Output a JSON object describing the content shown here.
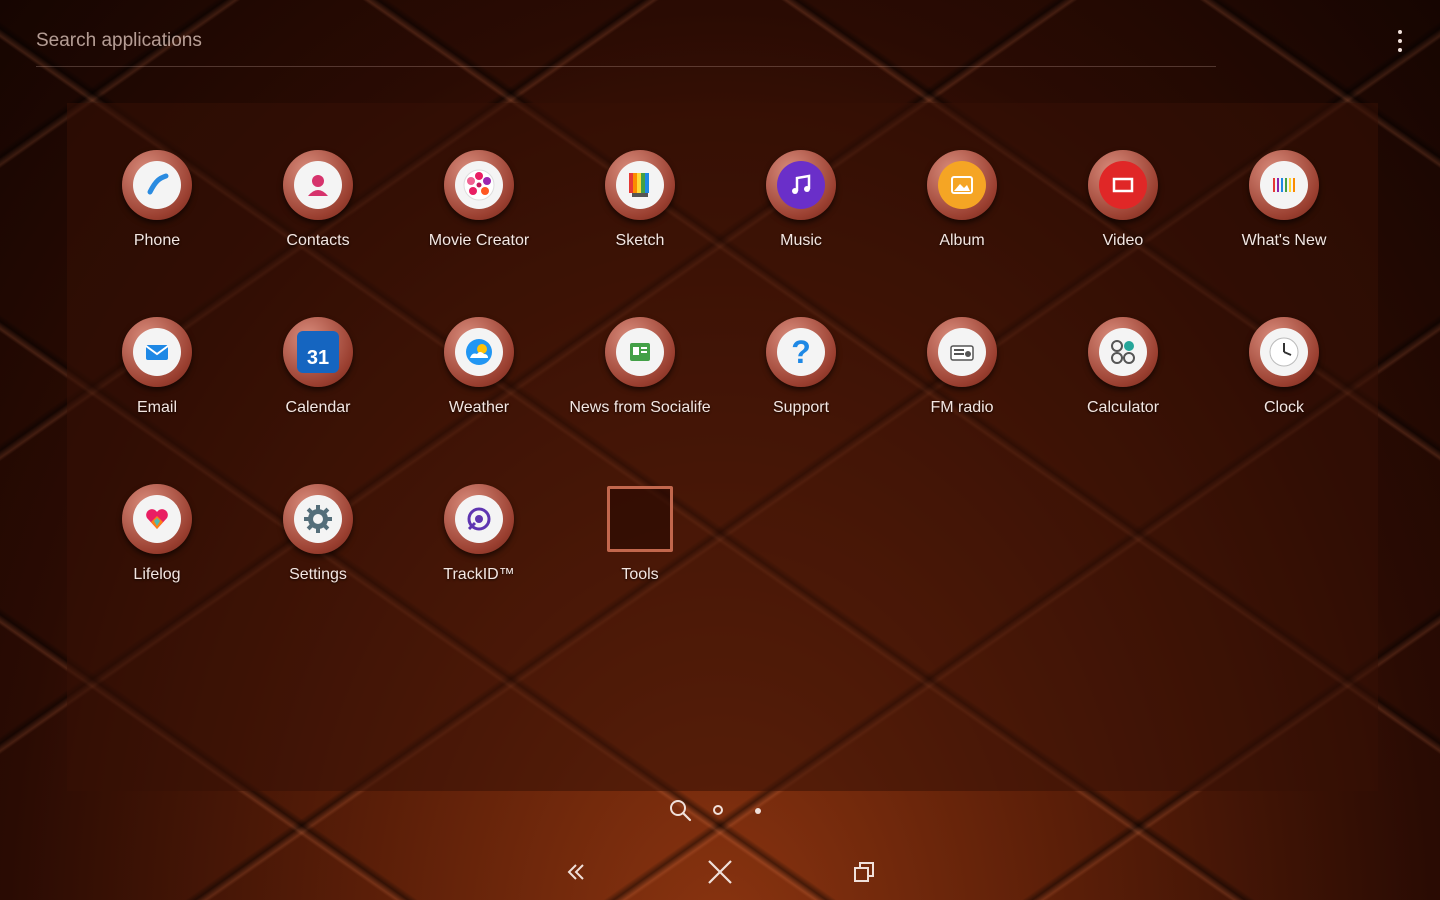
{
  "search": {
    "placeholder": "Search applications",
    "value": ""
  },
  "apps": [
    {
      "id": "phone",
      "label": "Phone",
      "icon": "phone-icon"
    },
    {
      "id": "contacts",
      "label": "Contacts",
      "icon": "contacts-icon"
    },
    {
      "id": "movie-creator",
      "label": "Movie Creator",
      "icon": "movie-creator-icon"
    },
    {
      "id": "sketch",
      "label": "Sketch",
      "icon": "sketch-icon"
    },
    {
      "id": "music",
      "label": "Music",
      "icon": "music-icon"
    },
    {
      "id": "album",
      "label": "Album",
      "icon": "album-icon"
    },
    {
      "id": "video",
      "label": "Video",
      "icon": "video-icon"
    },
    {
      "id": "whats-new",
      "label": "What's New",
      "icon": "whats-new-icon"
    },
    {
      "id": "email",
      "label": "Email",
      "icon": "email-icon"
    },
    {
      "id": "calendar",
      "label": "Calendar",
      "icon": "calendar-icon",
      "icon_text": "31"
    },
    {
      "id": "weather",
      "label": "Weather",
      "icon": "weather-icon"
    },
    {
      "id": "news-from-socialife",
      "label": "News from Socialife",
      "icon": "socialife-icon"
    },
    {
      "id": "support",
      "label": "Support",
      "icon": "support-icon",
      "icon_text": "?"
    },
    {
      "id": "fm-radio",
      "label": "FM radio",
      "icon": "fm-radio-icon"
    },
    {
      "id": "calculator",
      "label": "Calculator",
      "icon": "calculator-icon"
    },
    {
      "id": "clock",
      "label": "Clock",
      "icon": "clock-icon"
    },
    {
      "id": "lifelog",
      "label": "Lifelog",
      "icon": "lifelog-icon"
    },
    {
      "id": "settings",
      "label": "Settings",
      "icon": "gear-icon"
    },
    {
      "id": "trackid",
      "label": "TrackID™",
      "icon": "trackid-icon"
    },
    {
      "id": "tools",
      "label": "Tools",
      "icon": "folder-icon"
    }
  ],
  "pager": {
    "pages": 2,
    "current": 1
  },
  "nav": {
    "back_icon": "back-icon",
    "home_icon": "close-icon",
    "recents_icon": "recents-icon"
  }
}
